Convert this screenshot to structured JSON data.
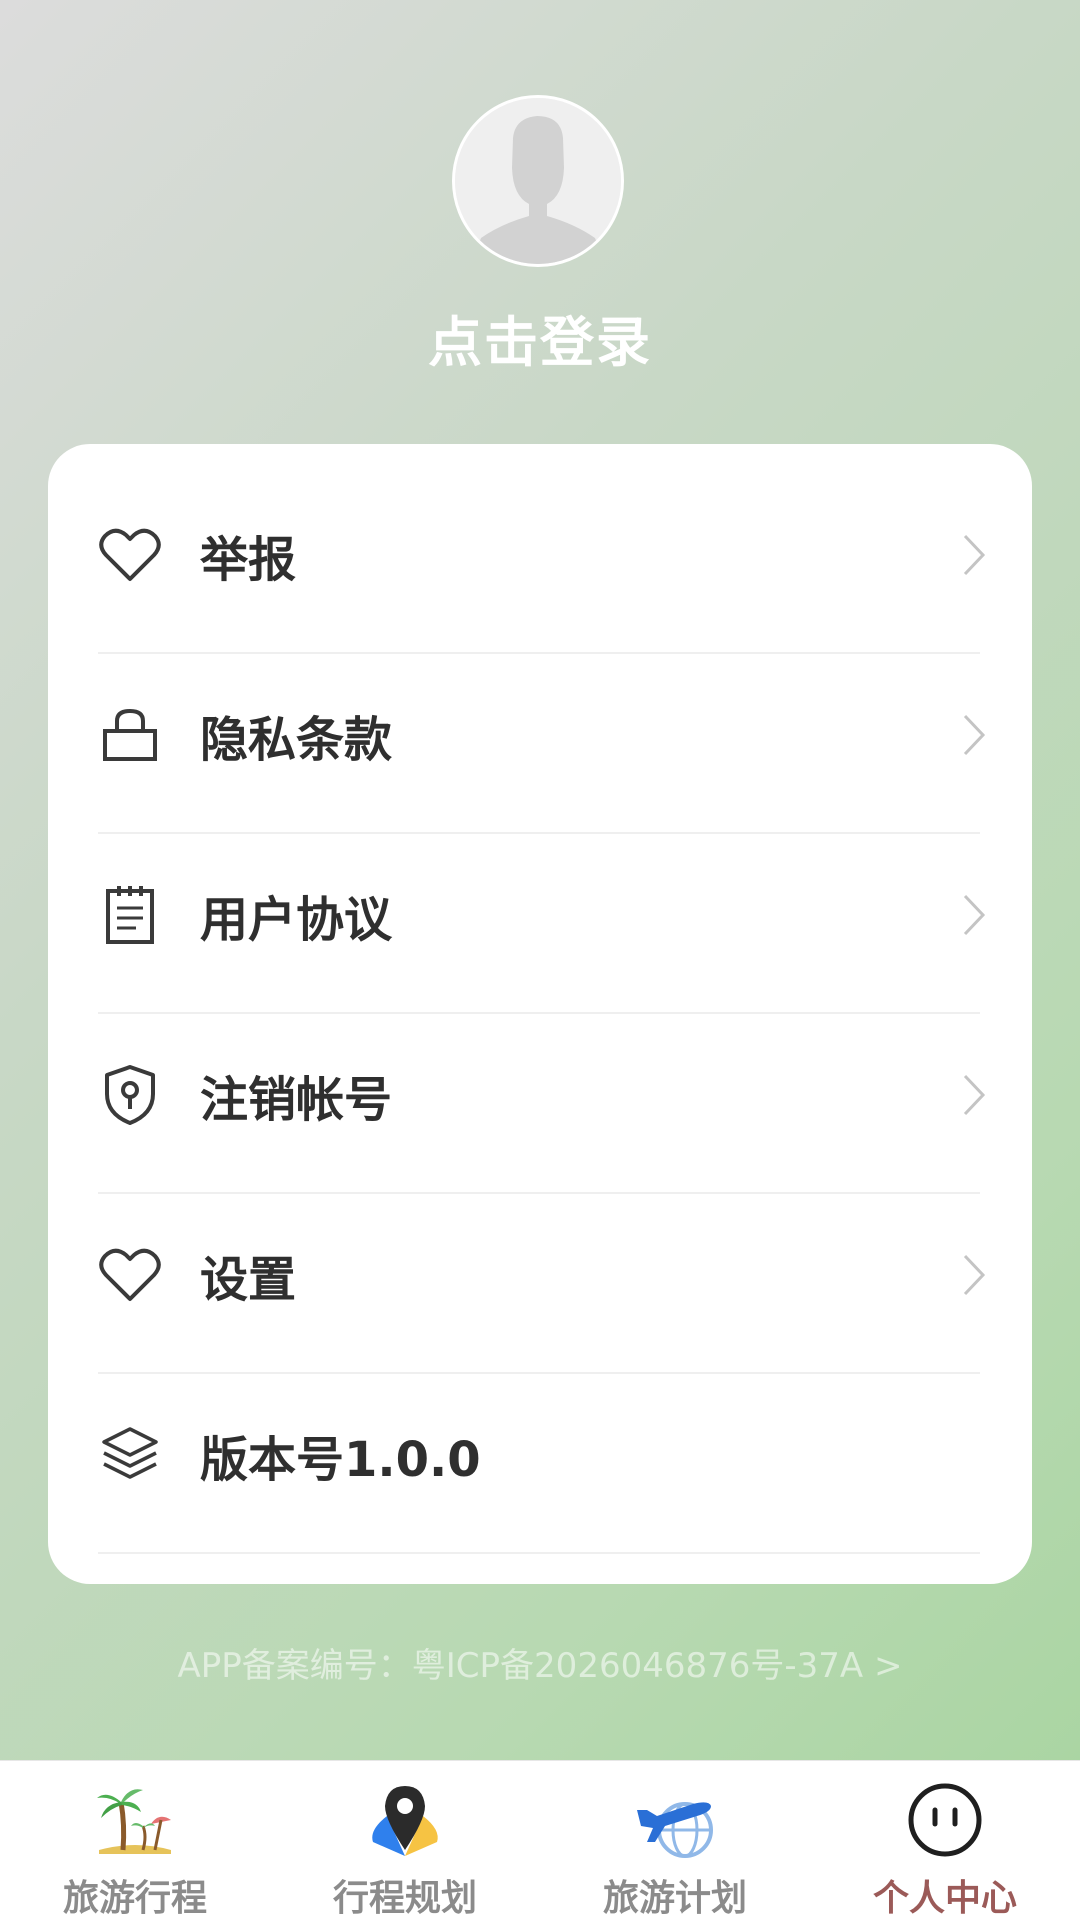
{
  "header": {
    "login_text": "点击登录"
  },
  "menu": {
    "items": [
      {
        "label": "举报",
        "icon": "heart-icon"
      },
      {
        "label": "隐私条款",
        "icon": "lock-icon"
      },
      {
        "label": "用户协议",
        "icon": "notepad-icon"
      },
      {
        "label": "注销帐号",
        "icon": "shield-keyhole-icon"
      },
      {
        "label": "设置",
        "icon": "heart-icon"
      },
      {
        "label": "版本号1.0.0",
        "icon": "layers-icon"
      }
    ]
  },
  "footer": {
    "icp": "APP备案编号：粤ICP备2026046876号-37A >"
  },
  "tabbar": {
    "tabs": [
      {
        "label": "旅游行程",
        "icon": "palm-tree-icon"
      },
      {
        "label": "行程规划",
        "icon": "map-pin-icon"
      },
      {
        "label": "旅游计划",
        "icon": "airplane-globe-icon"
      },
      {
        "label": "个人中心",
        "icon": "smiley-face-icon",
        "active": true
      }
    ]
  },
  "colors": {
    "active_tab": "#9b5a58",
    "inactive_tab": "#8b8b8b",
    "menu_text": "#2f2f2f"
  }
}
